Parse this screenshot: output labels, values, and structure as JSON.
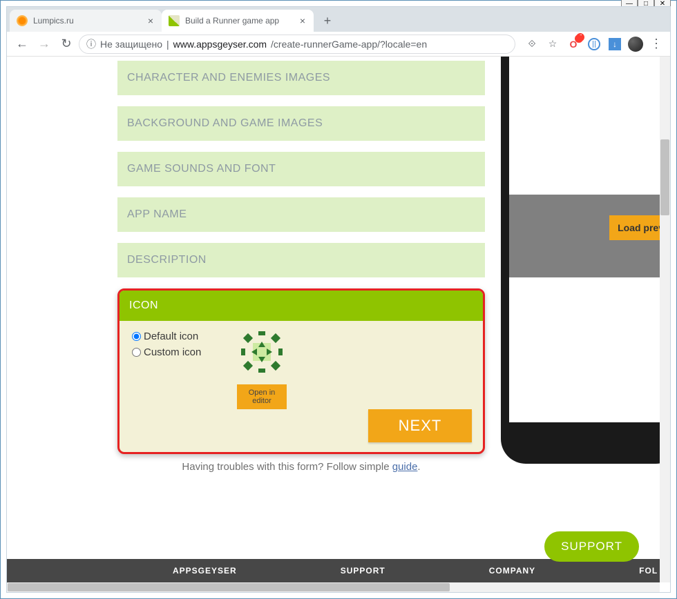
{
  "window": {
    "min": "—",
    "max": "□",
    "close": "✕"
  },
  "tabs": {
    "t0": {
      "title": "Lumpics.ru"
    },
    "t1": {
      "title": "Build a Runner game app"
    },
    "plus": "+"
  },
  "addr": {
    "back": "←",
    "fwd": "→",
    "reload": "↻",
    "infoicon": "ⓘ",
    "notsecure": "Не защищено",
    "sep": " | ",
    "domain": "www.appsgeyser.com",
    "path": "/create-runnerGame-app/?locale=en",
    "translate": "⟐",
    "star": "☆",
    "opera": "O",
    "down": "↓",
    "dots": "⋮",
    "badge7": "7"
  },
  "sections": {
    "s0": "CHARACTER AND ENEMIES IMAGES",
    "s1": "BACKGROUND AND GAME IMAGES",
    "s2": "GAME SOUNDS AND FONT",
    "s3": "APP NAME",
    "s4": "DESCRIPTION"
  },
  "iconPanel": {
    "title": "ICON",
    "optDefault": "Default icon",
    "optCustom": "Custom icon",
    "openEditor": "Open in editor",
    "next": "NEXT"
  },
  "troubles": {
    "text": "Having troubles with this form? Follow simple ",
    "link": "guide",
    "dot": "."
  },
  "phone": {
    "loadPrev": "Load prev"
  },
  "support": "SUPPORT",
  "footer": {
    "c0": "APPSGEYSER",
    "c1": "SUPPORT",
    "c2": "COMPANY",
    "c3": "FOL"
  }
}
